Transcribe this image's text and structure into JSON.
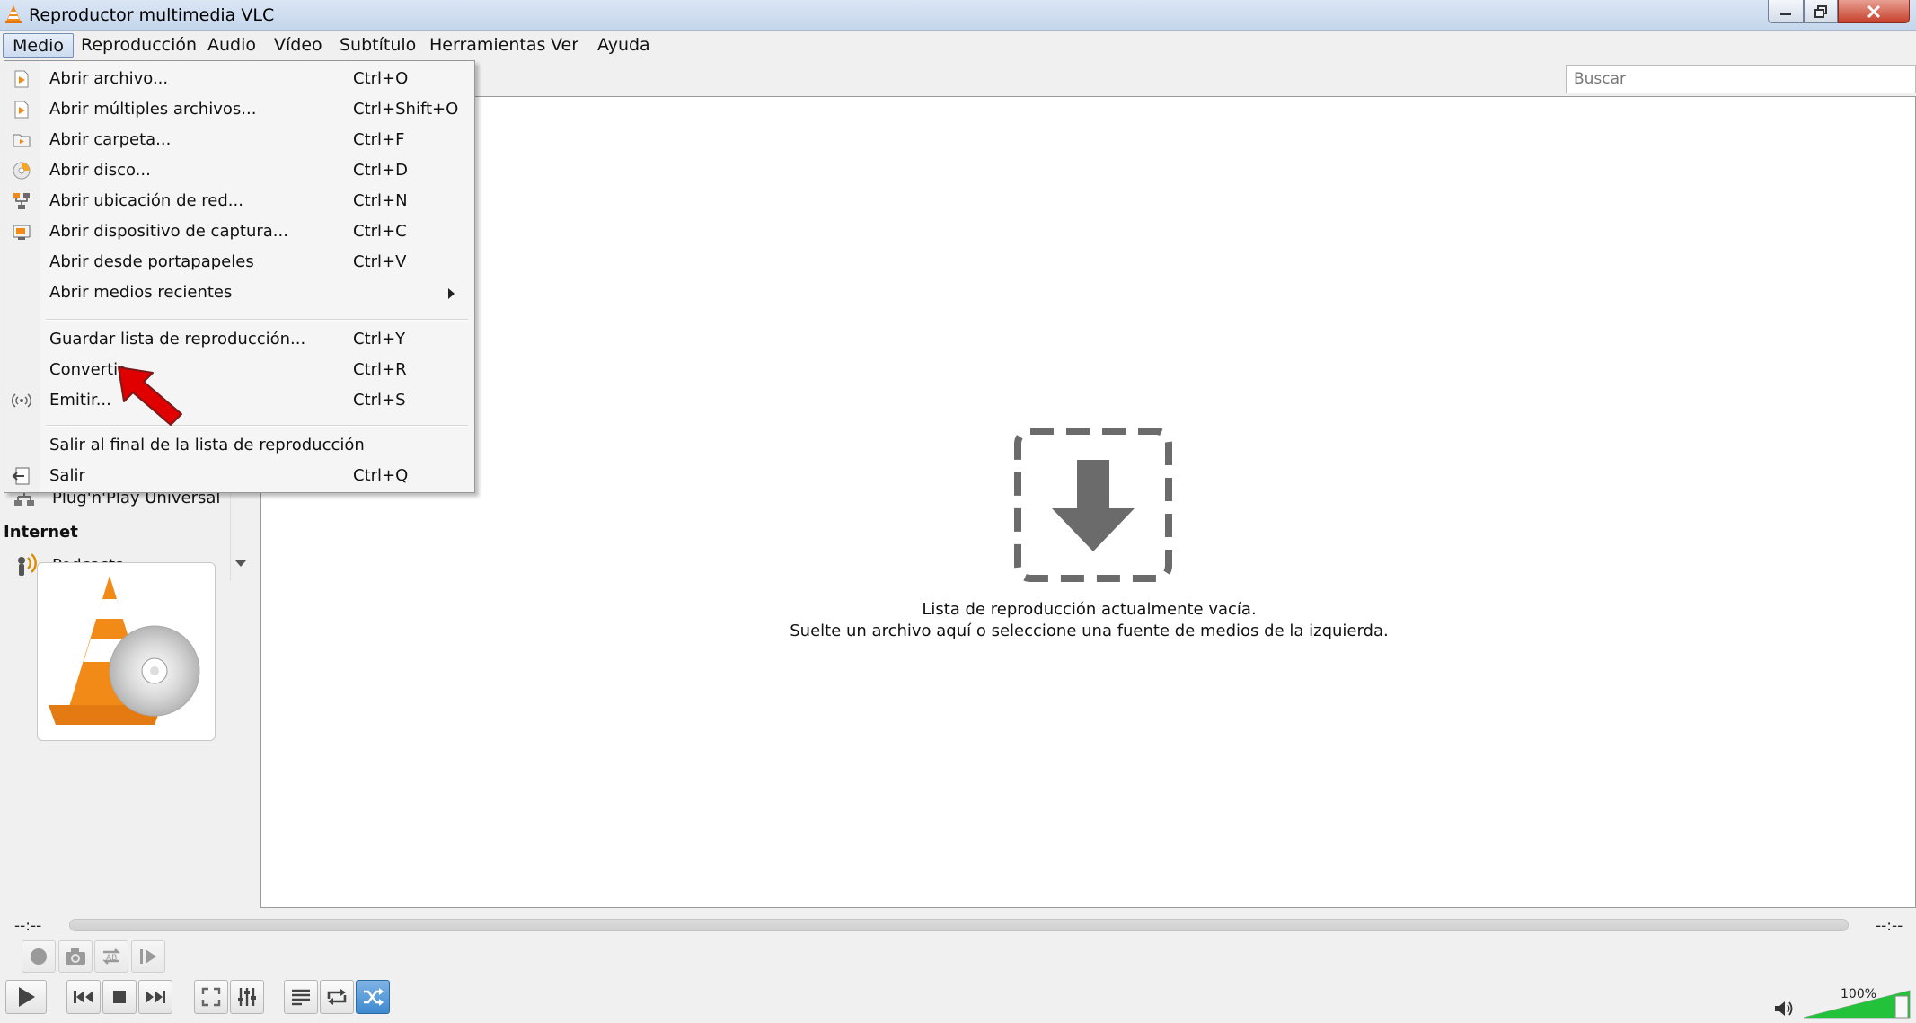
{
  "window": {
    "title": "Reproductor multimedia VLC"
  },
  "menubar": [
    {
      "label": "Medio",
      "active": true
    },
    {
      "label": "Reproducción"
    },
    {
      "label": "Audio"
    },
    {
      "label": "Vídeo"
    },
    {
      "label": "Subtítulo"
    },
    {
      "label": "Herramientas"
    },
    {
      "label": "Ver"
    },
    {
      "label": "Ayuda"
    }
  ],
  "medio_menu": [
    {
      "label": "Abrir archivo...",
      "shortcut": "Ctrl+O",
      "icon": "open-file-icon"
    },
    {
      "label": "Abrir múltiples archivos...",
      "shortcut": "Ctrl+Shift+O",
      "icon": "open-multiple-icon"
    },
    {
      "label": "Abrir carpeta...",
      "shortcut": "Ctrl+F",
      "icon": "open-folder-icon"
    },
    {
      "label": "Abrir disco...",
      "shortcut": "Ctrl+D",
      "icon": "disc-icon"
    },
    {
      "label": "Abrir ubicación de red...",
      "shortcut": "Ctrl+N",
      "icon": "network-icon"
    },
    {
      "label": "Abrir dispositivo de captura...",
      "shortcut": "Ctrl+C",
      "icon": "capture-device-icon"
    },
    {
      "label": "Abrir desde portapapeles",
      "shortcut": "Ctrl+V"
    },
    {
      "label": "Abrir medios recientes",
      "shortcut": "",
      "submenu": true
    },
    {
      "label": "Guardar lista de reproducción...",
      "shortcut": "Ctrl+Y"
    },
    {
      "label": "Convertir",
      "shortcut": "Ctrl+R"
    },
    {
      "label": "Emitir...",
      "shortcut": "Ctrl+S",
      "icon": "stream-icon"
    },
    {
      "label": "Salir al final de la lista de reproducción",
      "shortcut": ""
    },
    {
      "label": "Salir",
      "shortcut": "Ctrl+Q",
      "icon": "exit-icon"
    }
  ],
  "search": {
    "placeholder": "Buscar"
  },
  "sidebar": {
    "upnp_label": "Plug'n'Play Universal",
    "internet_heading": "Internet",
    "podcasts_label": "Podcasts"
  },
  "playlist": {
    "empty_line1": "Lista de reproducción actualmente vacía.",
    "empty_line2": "Suelte un archivo aquí o seleccione una fuente de medios de la izquierda."
  },
  "player": {
    "elapsed": "--:--",
    "remaining": "--:--",
    "volume": "100%",
    "volume_level": 1.0
  },
  "colors": {
    "accent": "#3e8ad0",
    "volume_green": "#22c23a",
    "annotation_red": "#e00000"
  }
}
